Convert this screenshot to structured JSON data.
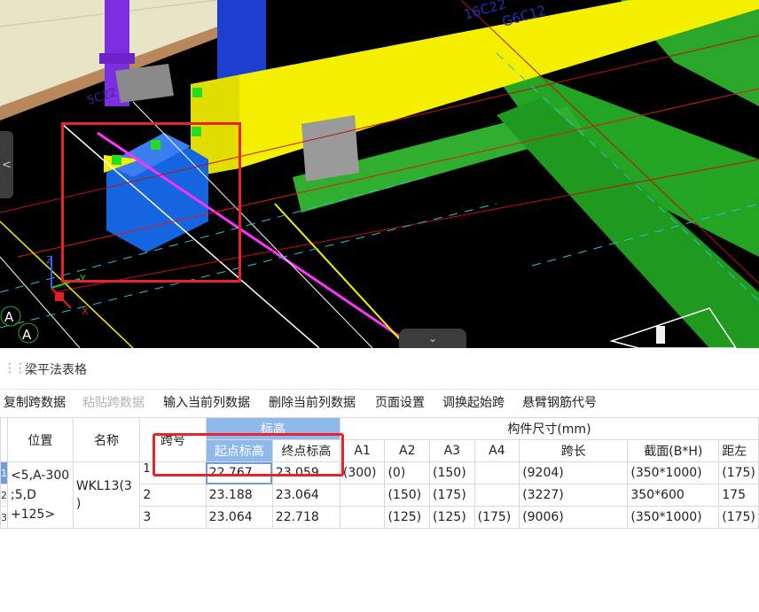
{
  "scene": {
    "labels": {
      "rebar_top": "16C22",
      "rebar_bottom": "G6C12",
      "purple_tag": "5C22",
      "axis_z": "Z",
      "axis_y": "Y",
      "axis_x": "X",
      "grid_a1": "A",
      "grid_a2": "A"
    },
    "left_handle_icon": "<",
    "bottom_handle_icon": "⌄"
  },
  "panel": {
    "title": "梁平法表格",
    "toolbar": [
      {
        "label": "复制跨数据",
        "enabled": true
      },
      {
        "label": "粘贴跨数据",
        "enabled": false
      },
      {
        "label": "输入当前列数据",
        "enabled": true
      },
      {
        "label": "删除当前列数据",
        "enabled": true
      },
      {
        "label": "页面设置",
        "enabled": true
      },
      {
        "label": "调换起始跨",
        "enabled": true
      },
      {
        "label": "悬臂钢筋代号",
        "enabled": true
      }
    ]
  },
  "table": {
    "headers": {
      "position": "位置",
      "name": "名称",
      "span_no": "跨号",
      "elevation_group": "标高",
      "start_elev": "起点标高",
      "end_elev": "终点标高",
      "dims_group": "构件尺寸(mm)",
      "a1": "A1",
      "a2": "A2",
      "a3": "A3",
      "a4": "A4",
      "span_len": "跨长",
      "section": "截面(B*H)",
      "dist_left": "距左"
    },
    "position_value": "<5,A-300;5,D+125>",
    "position_lines": [
      "<5,A-300",
      ";5,D",
      "+125>"
    ],
    "name_value": "WKL13(3)",
    "name_lines": [
      "WKL13(3",
      ")"
    ],
    "row_numbers": [
      "1",
      "2",
      "3"
    ],
    "rows": [
      {
        "span": "1",
        "start": "22.767",
        "end": "23.059",
        "a1": "(300)",
        "a2": "(0)",
        "a3": "(150)",
        "a4": "",
        "span_len": "(9204)",
        "section": "(350*1000)",
        "dist_left": "(175)"
      },
      {
        "span": "2",
        "start": "23.188",
        "end": "23.064",
        "a1": "",
        "a2": "(150)",
        "a3": "(175)",
        "a4": "",
        "span_len": "(3227)",
        "section": "350*600",
        "dist_left": "175"
      },
      {
        "span": "3",
        "start": "23.064",
        "end": "22.718",
        "a1": "",
        "a2": "(125)",
        "a3": "(125)",
        "a4": "(175)",
        "span_len": "(9006)",
        "section": "(350*1000)",
        "dist_left": "(175)"
      }
    ]
  },
  "colors": {
    "highlight_box": "#e8232a",
    "header_blue": "#8fb8ec",
    "beam_yellow": "#ffff00",
    "beam_green": "#2fa52f",
    "column_blue": "#1565e0",
    "background_3d": "#000000"
  }
}
